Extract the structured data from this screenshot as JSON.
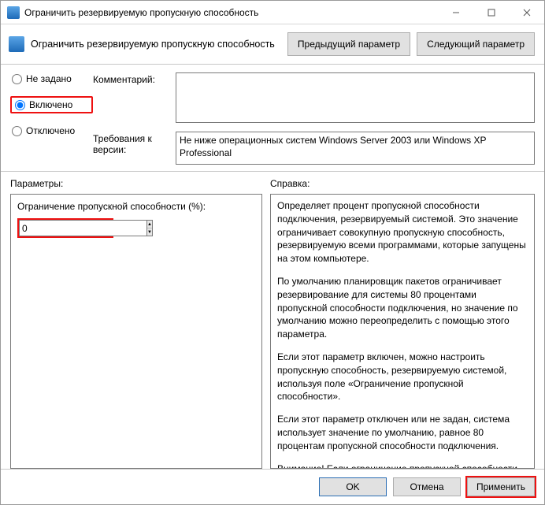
{
  "window": {
    "title": "Ограничить резервируемую пропускную способность"
  },
  "header": {
    "subtitle": "Ограничить резервируемую пропускную способность",
    "prev_label": "Предыдущий параметр",
    "next_label": "Следующий параметр"
  },
  "state": {
    "not_configured_label": "Не задано",
    "enabled_label": "Включено",
    "disabled_label": "Отключено",
    "selected": "enabled"
  },
  "fields": {
    "comment_label": "Комментарий:",
    "comment_value": "",
    "requirements_label": "Требования к версии:",
    "requirements_value": "Не ниже операционных систем Windows Server 2003 или Windows XP Professional"
  },
  "sections": {
    "parameters_label": "Параметры:",
    "help_label": "Справка:"
  },
  "parameter": {
    "bandwidth_limit_label": "Ограничение пропускной способности (%):",
    "bandwidth_limit_value": "0"
  },
  "help": {
    "p1": "Определяет процент пропускной способности подключения, резервируемый системой. Это значение ограничивает совокупную пропускную способность, резервируемую всеми программами, которые запущены на этом компьютере.",
    "p2": "По умолчанию планировщик пакетов ограничивает резервирование для системы 80 процентами пропускной способности подключения, но значение по умолчанию можно переопределить с помощью этого параметра.",
    "p3": "Если этот параметр включен, можно настроить пропускную способность, резервируемую системой, используя поле «Ограничение пропускной способности».",
    "p4": "Если этот параметр отключен или не задан, система использует значение по умолчанию, равное 80 процентам пропускной способности подключения.",
    "p5": "Внимание! Если ограничение пропускной способности для конкретного сетевого адаптера задано в реестре,"
  },
  "footer": {
    "ok_label": "OK",
    "cancel_label": "Отмена",
    "apply_label": "Применить"
  }
}
